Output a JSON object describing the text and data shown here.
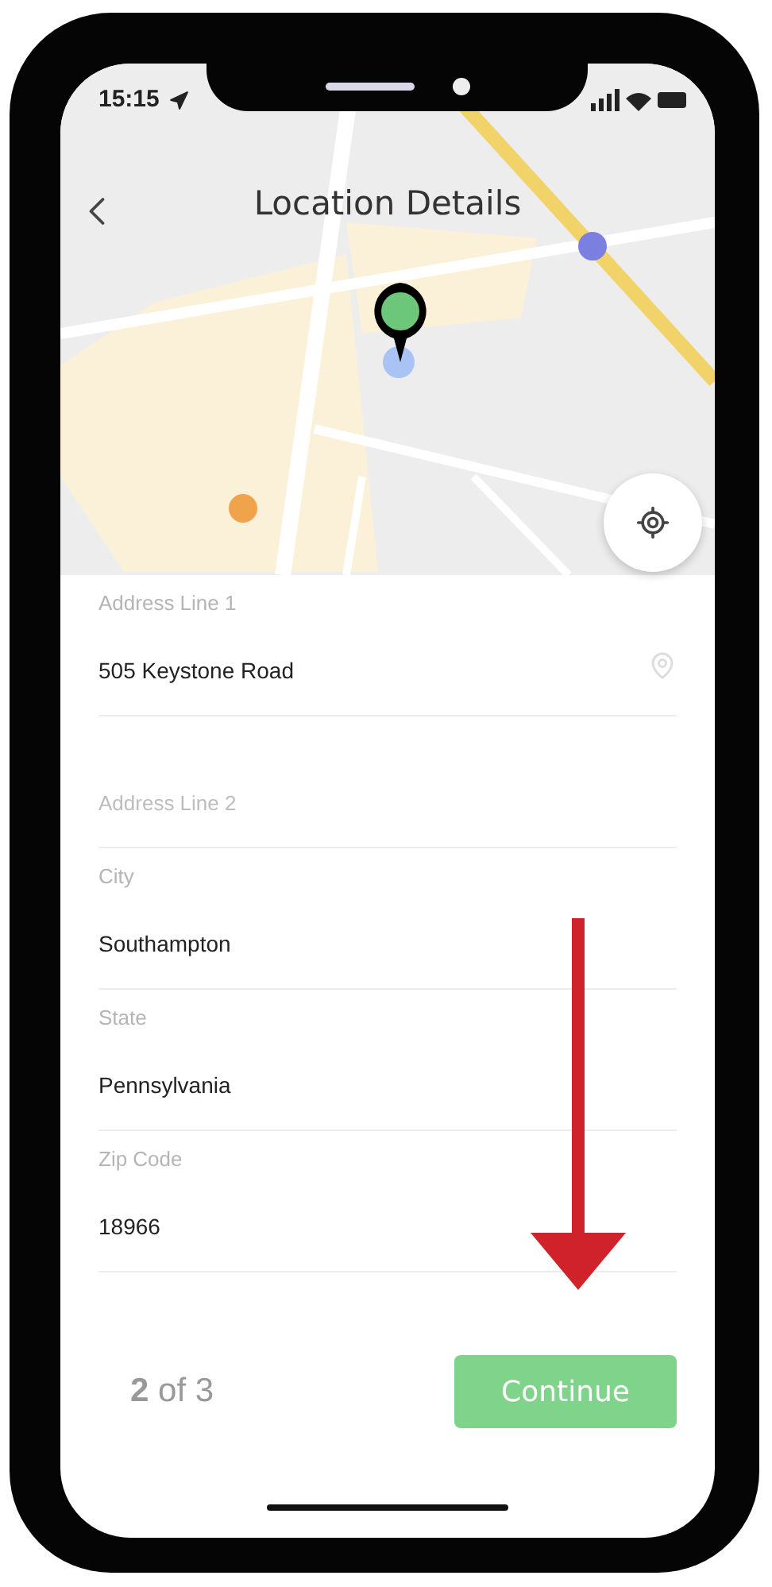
{
  "status_bar": {
    "time": "15:15"
  },
  "header": {
    "title": "Location Details"
  },
  "fields": [
    {
      "kind": "location",
      "label": "Address Line 1",
      "value": "505 Keystone Road"
    },
    {
      "kind": "text",
      "placeholder": "Address Line 2"
    },
    {
      "kind": "text",
      "label": "City",
      "value": "Southampton"
    },
    {
      "kind": "text",
      "label": "State",
      "value": "Pennsylvania"
    },
    {
      "kind": "text",
      "label": "Zip Code",
      "value": "18966"
    }
  ],
  "footer": {
    "step": "**2** of 3",
    "button": "Continue"
  }
}
